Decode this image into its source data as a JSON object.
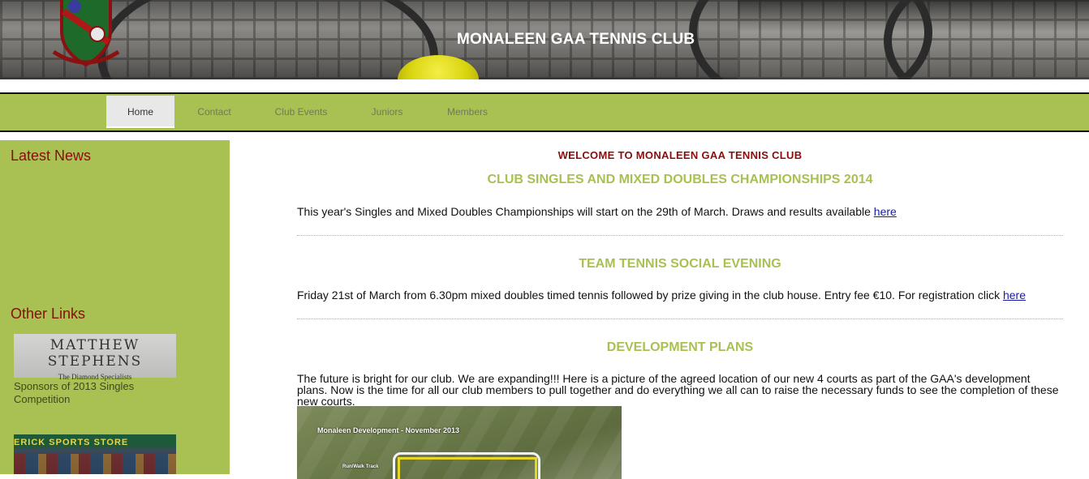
{
  "header": {
    "title": "MONALEEN GAA TENNIS CLUB",
    "logo_icon": "club-crest-icon"
  },
  "nav": {
    "items": [
      {
        "label": "Home",
        "active": true
      },
      {
        "label": "Contact",
        "active": false
      },
      {
        "label": "Club Events",
        "active": false
      },
      {
        "label": "Juniors",
        "active": false
      },
      {
        "label": "Members",
        "active": false
      }
    ]
  },
  "sidebar": {
    "latest_news_heading": "Latest News",
    "other_links_heading": "Other Links",
    "sponsor_logo_name": "MATTHEW STEPHENS",
    "sponsor_logo_tagline": "The Diamond Specialists",
    "sponsor_caption": "Sponsors of 2013 Singles Competition",
    "shop_sign": "ERICK SPORTS STORE"
  },
  "main": {
    "welcome": "WELCOME TO MONALEEN GAA TENNIS CLUB",
    "sections": [
      {
        "title": "CLUB SINGLES AND MIXED DOUBLES CHAMPIONSHIPS 2014",
        "text": "This year's Singles and Mixed Doubles Championships will start on the 29th of March. Draws and results available ",
        "link": "here"
      },
      {
        "title": "TEAM TENNIS SOCIAL EVENING",
        "text": "Friday 21st of March from 6.30pm mixed doubles timed tennis followed by prize giving in the club house. Entry fee €10. For registration click ",
        "link": "here"
      },
      {
        "title": "DEVELOPMENT PLANS",
        "text": "The future is bright for our club. We are expanding!!! Here is a picture of the agreed location of our new 4 courts as part of the GAA's development plans. Now is the time for all our club members to pull together and do everything we all can to raise the necessary funds to see the completion of these new courts."
      }
    ],
    "aerial_caption": "Monaleen Development - November 2013",
    "aerial_label": "Run/Walk Track"
  },
  "colors": {
    "accent_green": "#a9c053",
    "heading_red": "#8b0d0d",
    "link_blue": "#1a1aa6"
  }
}
